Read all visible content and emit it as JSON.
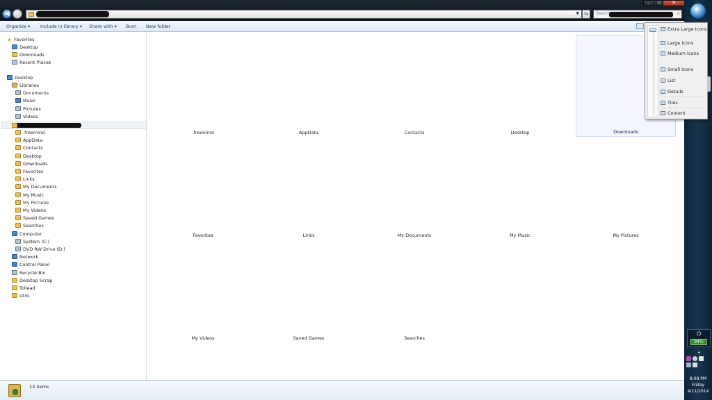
{
  "window": {
    "address": {
      "redacted": true
    },
    "search": {
      "placeholder": "Search"
    },
    "buttons": {
      "minimize": "–",
      "maximize": "▫",
      "close": "✕"
    }
  },
  "toolbar": {
    "organize": "Organize ▾",
    "include_in_library": "Include in library ▾",
    "share_with": "Share with ▾",
    "burn": "Burn",
    "new_folder": "New folder"
  },
  "nav": {
    "favorites": "Favorites",
    "desktop_fav": "Desktop",
    "downloads_fav": "Downloads",
    "recent_places": "Recent Places",
    "desktop": "Desktop",
    "libraries": "Libraries",
    "documents": "Documents",
    "music": "Music",
    "pictures": "Pictures",
    "videos": "Videos",
    "user_folders": [
      ".freemind",
      "AppData",
      "Contacts",
      "Desktop",
      "Downloads",
      "Favorites",
      "Links",
      "My Documents",
      "My Music",
      "My Pictures",
      "My Videos",
      "Saved Games",
      "Searches"
    ],
    "computer": "Computer",
    "system_c": "System (C:)",
    "dvd": "DVD RW Drive (D:)",
    "network": "Network",
    "control_panel": "Control Panel",
    "recycle_bin": "Recycle Bin",
    "desktop_scrap": "Desktop Scrap",
    "tollead": "Tollead",
    "utils": "Utils"
  },
  "content": {
    "tiles": [
      ".freemind",
      "AppData",
      "Contacts",
      "Desktop",
      "Downloads",
      "Favorites",
      "Links",
      "My Documents",
      "My Music",
      "My Pictures",
      "My Videos",
      "Saved Games",
      "Searches"
    ],
    "selected_tile": "Downloads"
  },
  "status": {
    "item_count": "13 items"
  },
  "view_menu": {
    "extra_large": "Extra Large Icons",
    "large": "Large Icons",
    "medium": "Medium Icons",
    "small": "Small Icons",
    "list": "List",
    "details": "Details",
    "tiles": "Tiles",
    "content": "Content"
  },
  "taskbar": {
    "battery": "94%",
    "battery_level": 0.94,
    "time": "8:09 PM",
    "day": "Friday",
    "date": "4/11/2014"
  },
  "colors": {
    "accent": "#2a66b8",
    "folder": "#e8c05e",
    "selection": "#f2f7fd",
    "taskbar": "#16344c"
  }
}
